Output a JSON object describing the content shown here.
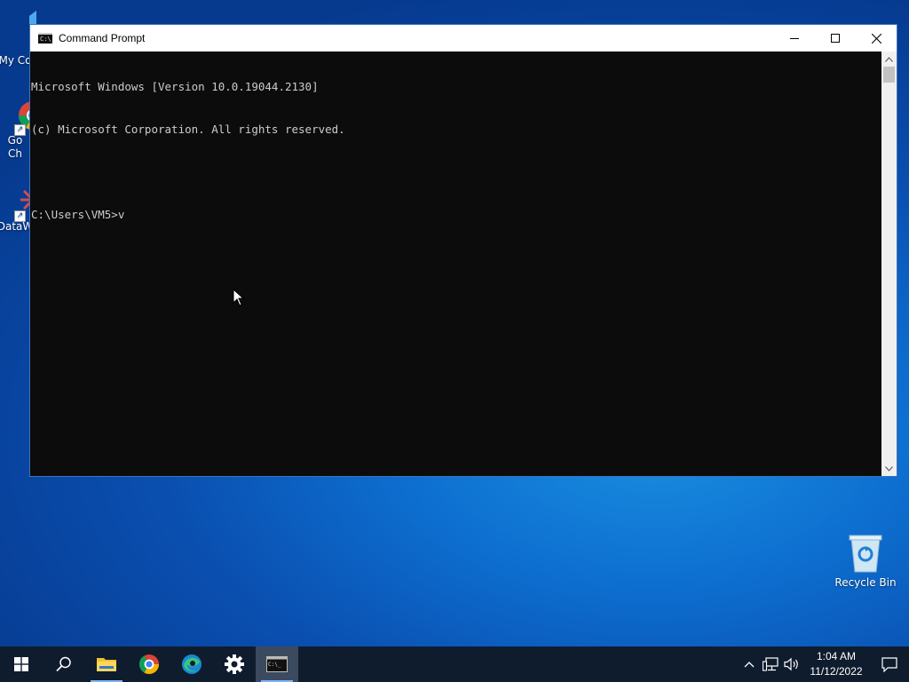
{
  "desktop": {
    "icons": [
      {
        "label": "My Co"
      },
      {
        "label": "Go\nCh"
      },
      {
        "label": "DataW"
      },
      {
        "label": "Recycle Bin"
      }
    ]
  },
  "window": {
    "title": "Command Prompt",
    "app_icon_text": "C:\\_",
    "console_lines": [
      "Microsoft Windows [Version 10.0.19044.2130]",
      "(c) Microsoft Corporation. All rights reserved.",
      "",
      "C:\\Users\\VM5>v"
    ]
  },
  "taskbar": {
    "items": [
      {
        "name": "start",
        "icon": "windows-logo-icon"
      },
      {
        "name": "search",
        "icon": "search-icon"
      },
      {
        "name": "file-explorer",
        "icon": "folder-icon",
        "running": true
      },
      {
        "name": "chrome",
        "icon": "chrome-icon"
      },
      {
        "name": "edge",
        "icon": "edge-icon"
      },
      {
        "name": "settings",
        "icon": "gear-icon"
      },
      {
        "name": "command-prompt",
        "icon": "terminal-icon",
        "active": true
      }
    ],
    "clock": {
      "time": "1:04 AM",
      "date": "11/12/2022"
    }
  },
  "colors": {
    "taskbar": "#0f1c2e",
    "console_bg": "#0c0c0c",
    "console_text": "#cccccc",
    "desktop_accent": "#0d6fd0"
  }
}
